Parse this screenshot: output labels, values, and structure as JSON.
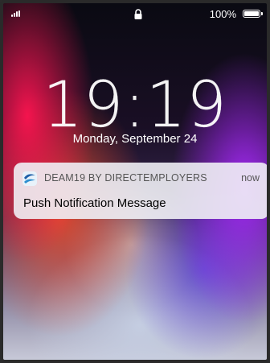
{
  "status_bar": {
    "signal_icon": "signal-bars-icon",
    "lock_icon": "lock-icon",
    "battery_percent": "100%",
    "battery_icon": "battery-full-icon"
  },
  "lock_screen": {
    "time": "19:19",
    "date": "Monday, September 24"
  },
  "notification": {
    "app_icon": "deam19-app-icon",
    "app_name": "DEAM19 BY DIRECTEMPLOYERS",
    "time": "now",
    "message": "Push Notification Message",
    "app_icon_colors": [
      "#1f5fa8",
      "#e8f2fa",
      "#2e8fd0"
    ]
  }
}
